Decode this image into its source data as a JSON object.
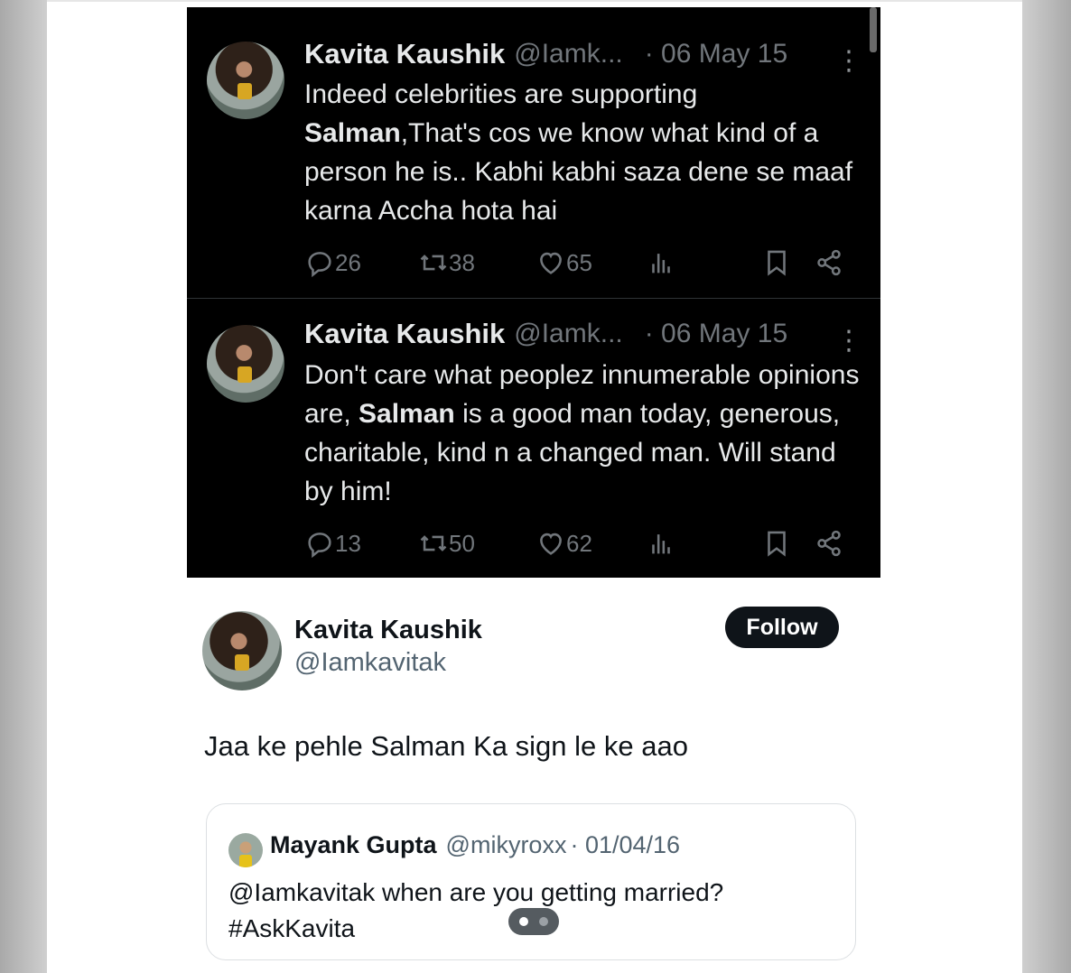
{
  "colors": {
    "dark_bg": "#000000",
    "dark_text": "#e7e9ea",
    "dark_muted": "#71767b",
    "follow_bg": "#0f1419",
    "light_muted": "#536471"
  },
  "screenshot_tweets": [
    {
      "name": "Kavita Kaushik",
      "handle": "@Iamk...",
      "date": "· 06 May 15",
      "more_icon": "more-vertical-icon",
      "body_line1": "Indeed celebrities are supporting",
      "body_bold": "Salman",
      "body_rest": ",That's cos we know what kind of a person he is.. Kabhi kabhi saza dene se maaf karna Accha hota hai",
      "replies": "26",
      "retweets": "38",
      "likes": "65"
    },
    {
      "name": "Kavita Kaushik",
      "handle": "@Iamk...",
      "date": "· 06 May 15",
      "more_icon": "more-vertical-icon",
      "body_pre": "Don't care what peoplez innumerable opinions are, ",
      "body_bold": "Salman",
      "body_rest": " is a good man today, generous, charitable, kind n a changed man. Will stand by him!",
      "replies": "13",
      "retweets": "50",
      "likes": "62"
    }
  ],
  "main_tweet": {
    "name": "Kavita Kaushik",
    "handle": "@Iamkavitak",
    "follow_label": "Follow",
    "text": "Jaa ke pehle Salman Ka sign le ke aao"
  },
  "quoted_tweet": {
    "name": "Mayank Gupta",
    "handle": "@mikyroxx",
    "date": "· 01/04/16",
    "text_line1": "@Iamkavitak when are you getting married?",
    "text_line2": "#AskKavita"
  }
}
